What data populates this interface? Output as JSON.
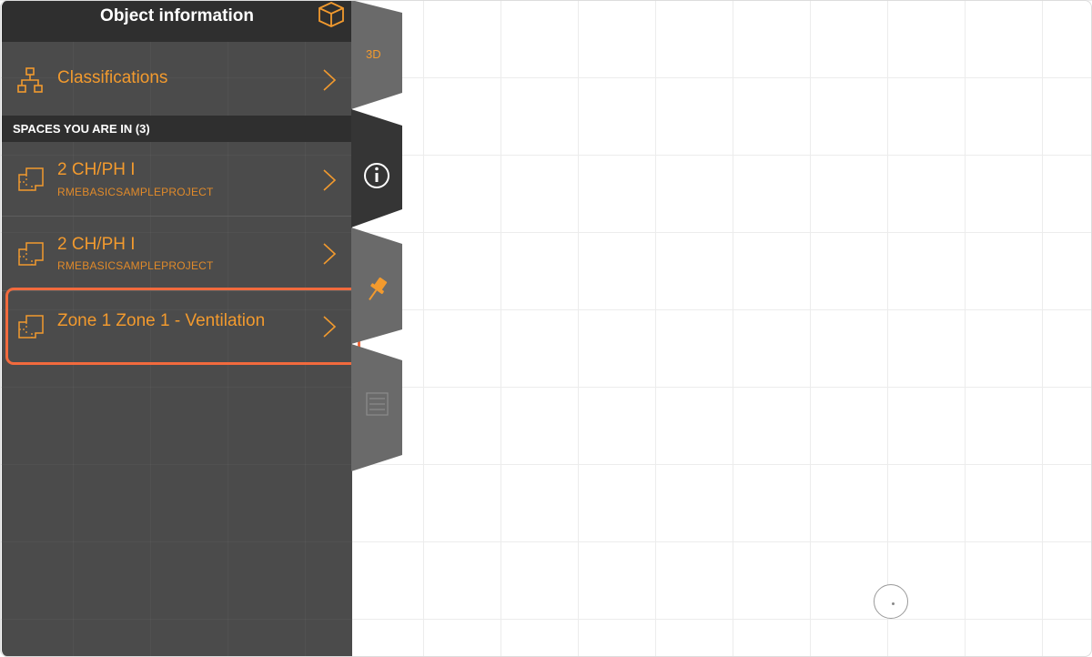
{
  "panel": {
    "title": "Object information",
    "header_icon": "cube-icon"
  },
  "classifications": {
    "label": "Classifications",
    "icon": "hierarchy-icon"
  },
  "section": {
    "label": "SPACES YOU ARE IN (3)"
  },
  "spaces": [
    {
      "title": "2 CH/PH I",
      "subtitle": "RMEBASICSAMPLEPROJECT",
      "icon": "floorplan-icon"
    },
    {
      "title": "2 CH/PH I",
      "subtitle": "RMEBASICSAMPLEPROJECT",
      "icon": "floorplan-icon"
    },
    {
      "title": "Zone 1 Zone 1 - Ventilation",
      "subtitle": "",
      "icon": "floorplan-icon"
    }
  ],
  "side_tabs": [
    {
      "label": "3D",
      "icon": "3d-icon"
    },
    {
      "label": "",
      "icon": "info-icon"
    },
    {
      "label": "",
      "icon": "pin-icon"
    },
    {
      "label": "",
      "icon": "list-icon"
    }
  ],
  "colors": {
    "accent": "#f29a2e",
    "panel_bg": "#4b4b4b",
    "header_bg": "#2f2f2f",
    "highlight": "#f26a3d"
  }
}
